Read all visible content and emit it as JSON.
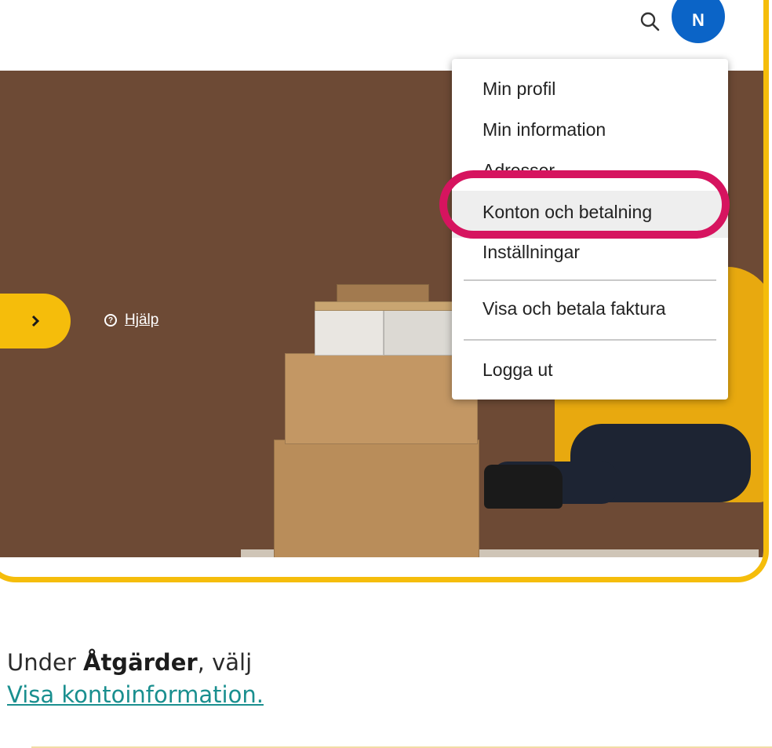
{
  "header": {
    "avatar_initial": "N",
    "icons": [
      "search-icon"
    ]
  },
  "hero": {
    "help_label": "Hjälp",
    "side_tab_icon": "chevron-right-icon"
  },
  "menu": {
    "items": [
      {
        "label": "Min profil"
      },
      {
        "label": "Min information"
      },
      {
        "label": "Adresser"
      },
      {
        "label": "Konton och betalning",
        "highlighted": true
      },
      {
        "label": "Inställningar"
      },
      {
        "label": "Visa och betala faktura"
      },
      {
        "label": "Logga ut"
      }
    ]
  },
  "caption": {
    "prefix": "Under ",
    "bold": "Åtgärder",
    "suffix": ", välj",
    "link": "Visa kontoinformation."
  },
  "colors": {
    "frame": "#f5bd0b",
    "highlight": "#d6145f",
    "avatar": "#0b64c7",
    "link": "#1a8f8f"
  }
}
